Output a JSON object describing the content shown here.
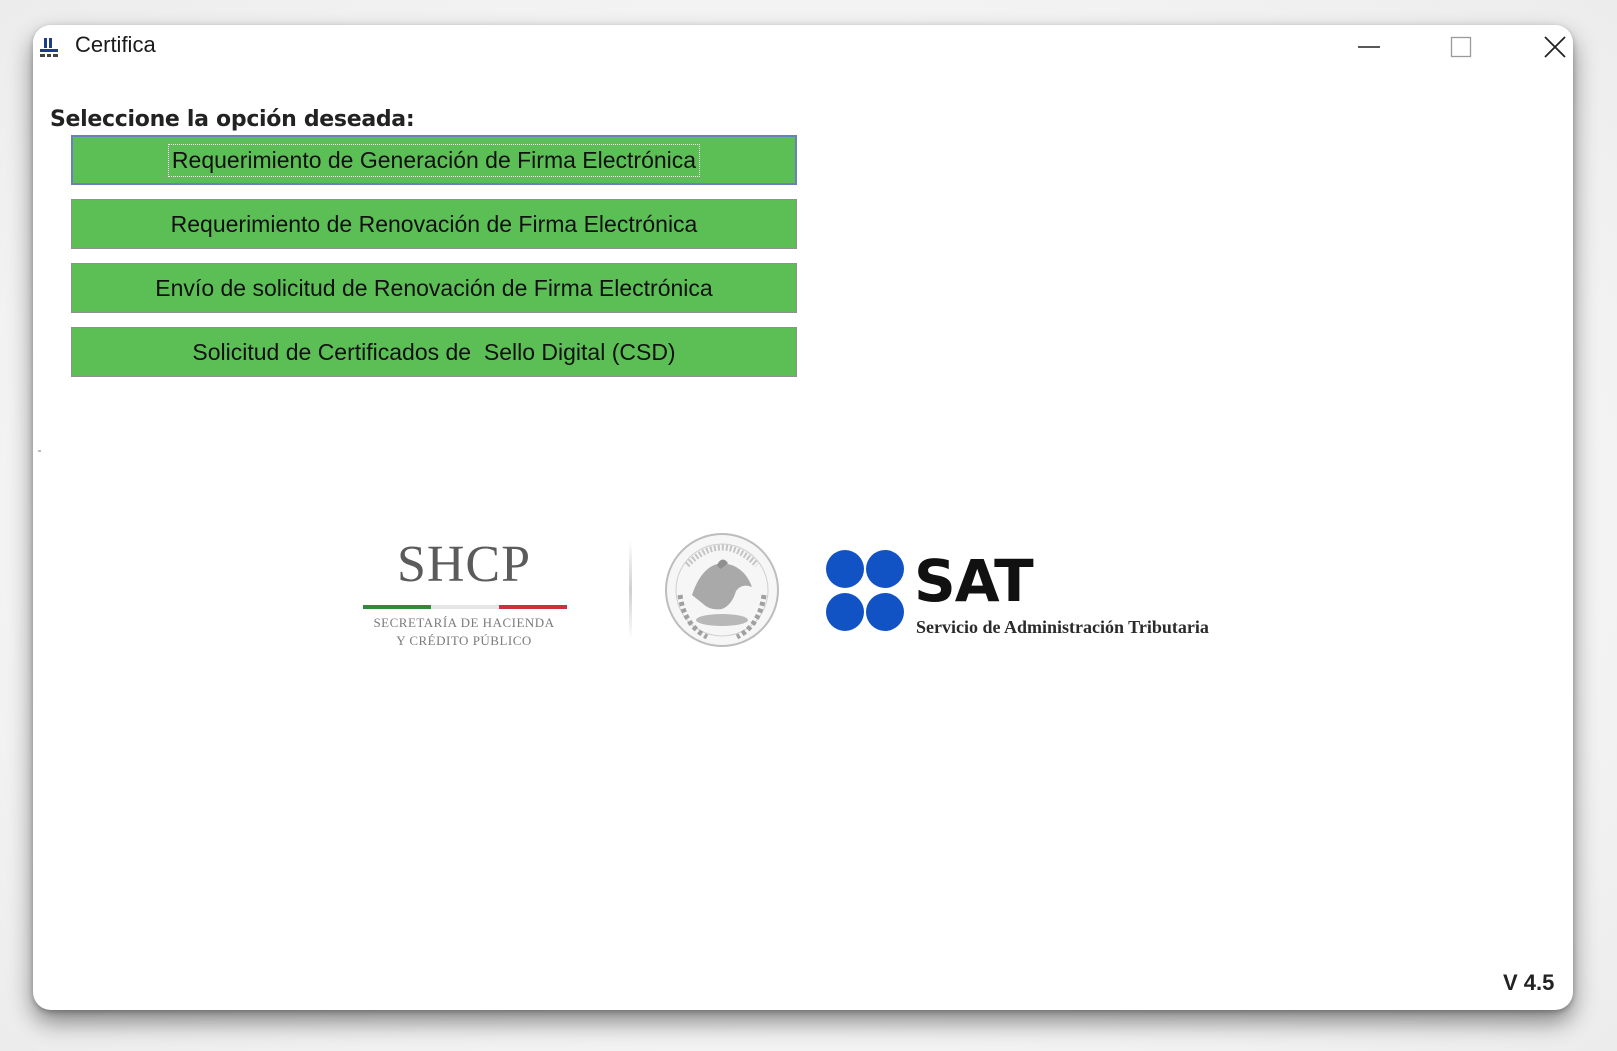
{
  "window": {
    "title": "Certifica",
    "controls": {
      "minimize": "minimize",
      "maximize": "maximize",
      "close": "close"
    }
  },
  "main": {
    "prompt": "Seleccione la opción deseada:",
    "options": [
      {
        "label": "Requerimiento de Generación de Firma Electrónica",
        "focused": true
      },
      {
        "label": "Requerimiento de Renovación de Firma Electrónica",
        "focused": false
      },
      {
        "label": "Envío de solicitud de Renovación de Firma Electrónica",
        "focused": false
      },
      {
        "label": "Solicitud de Certificados de  Sello Digital (CSD)",
        "focused": false
      }
    ]
  },
  "logos": {
    "shcp": {
      "title": "SHCP",
      "line1": "SECRETARÍA DE HACIENDA",
      "line2": "Y CRÉDITO PÚBLICO"
    },
    "seal": "estados-unidos-mexicanos-seal",
    "sat": {
      "title": "SAT",
      "subtitle": "Servicio de Administración Tributaria"
    }
  },
  "footer": {
    "version": "V 4.5"
  },
  "colors": {
    "button_green": "#5cbf55",
    "sat_blue": "#1152c4",
    "flag_green": "#2e8b3d",
    "flag_red": "#c8323c"
  }
}
